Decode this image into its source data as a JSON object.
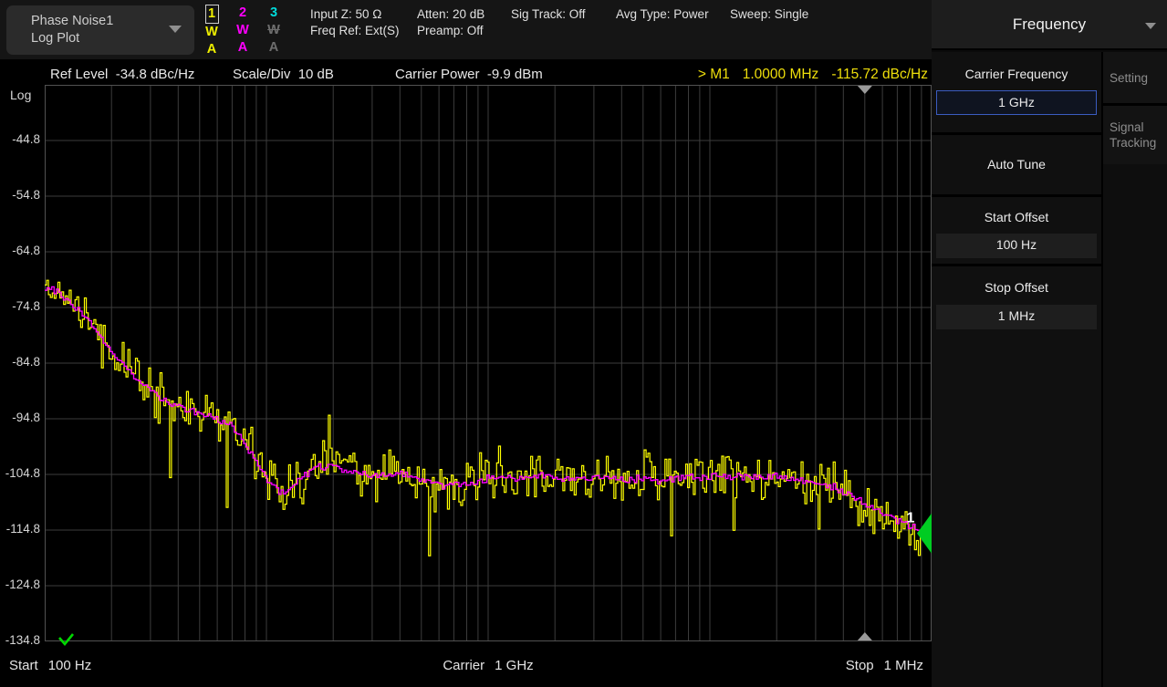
{
  "header": {
    "measurement_title": "Phase Noise1",
    "measurement_subtitle": "Log Plot",
    "traces": [
      {
        "id": "1",
        "detector": "W",
        "average": "A",
        "color": "#f0f000",
        "selected": true,
        "enabled": true
      },
      {
        "id": "2",
        "detector": "W",
        "average": "A",
        "color": "#ff00ff",
        "selected": false,
        "enabled": true
      },
      {
        "id": "3",
        "detector": "W",
        "average": "A",
        "color": "#00dcdc",
        "disabled_color": "#6e6e6e",
        "selected": false,
        "enabled": false
      }
    ],
    "settings": [
      {
        "line1": "Input Z: 50 Ω",
        "line2": "Freq Ref: Ext(S)"
      },
      {
        "line1": "Atten: 20 dB",
        "line2": "Preamp: Off"
      },
      {
        "line1": "Sig Track: Off",
        "line2": ""
      },
      {
        "line1": "Avg Type: Power",
        "line2": ""
      },
      {
        "line1": "Sweep: Single",
        "line2": ""
      }
    ]
  },
  "chart_header": {
    "ref_level": "Ref Level  -34.8 dBc/Hz",
    "scale_div": "Scale/Div  10 dB",
    "carrier_power": "Carrier Power  -9.9 dBm",
    "marker": {
      "prefix": "> M1",
      "freq": "1.0000 MHz",
      "value": "-115.72 dBc/Hz"
    }
  },
  "footer": {
    "start_label": "Start",
    "start_value": "100 Hz",
    "carrier_label": "Carrier",
    "carrier_value": "1 GHz",
    "stop_label": "Stop",
    "stop_value": "1 MHz"
  },
  "side_panel": {
    "title": "Frequency",
    "sections": [
      {
        "label": "Carrier Frequency",
        "value": "1 GHz",
        "highlighted": true
      },
      {
        "label": "Auto Tune"
      },
      {
        "label": "Start Offset",
        "value": "100 Hz"
      },
      {
        "label": "Stop Offset",
        "value": "1 MHz"
      }
    ],
    "tabs": [
      {
        "label": "Setting"
      },
      {
        "label_line1": "Signal",
        "label_line2": "Tracking"
      }
    ]
  },
  "chart_data": {
    "type": "line",
    "title": "Phase Noise1 Log Plot",
    "x_scale": "log",
    "x_range_hz": [
      100,
      1000000
    ],
    "y_top_dbchz": -34.8,
    "y_bottom_dbchz": -134.8,
    "scale_per_div_db": 10,
    "ylabel": "Log",
    "y_ticks": [
      "-44.8",
      "-54.8",
      "-64.8",
      "-74.8",
      "-84.8",
      "-94.8",
      "-104.8",
      "-114.8",
      "-124.8",
      "-134.8"
    ],
    "grid_color": "#3c3c3c",
    "frame_color": "#525252",
    "edge_tick_hz": 500000,
    "edge_tick_color": "#9a9a9a",
    "series": [
      {
        "name": "Trace 1 raw (W)",
        "color": "#ffff00",
        "style": "noisy-step",
        "peak_noise_db": 10
      },
      {
        "name": "Trace 2 smoothed (W)",
        "color": "#ff00ff",
        "style": "smooth-step"
      }
    ],
    "envelope_points_hz_dbchz": [
      [
        100,
        -71.3
      ],
      [
        112,
        -71.8
      ],
      [
        125,
        -73.2
      ],
      [
        140,
        -75.0
      ],
      [
        160,
        -77.5
      ],
      [
        180,
        -80.5
      ],
      [
        200,
        -83.0
      ],
      [
        230,
        -85.5
      ],
      [
        260,
        -87.5
      ],
      [
        300,
        -89.8
      ],
      [
        350,
        -91.5
      ],
      [
        400,
        -92.6
      ],
      [
        450,
        -93.2
      ],
      [
        500,
        -93.8
      ],
      [
        560,
        -94.6
      ],
      [
        630,
        -95.4
      ],
      [
        700,
        -96.5
      ],
      [
        800,
        -99.5
      ],
      [
        900,
        -102.8
      ],
      [
        1000,
        -105.6
      ],
      [
        1150,
        -108.0
      ],
      [
        1300,
        -107.0
      ],
      [
        1500,
        -104.8
      ],
      [
        1700,
        -103.4
      ],
      [
        2000,
        -103.2
      ],
      [
        2300,
        -104.2
      ],
      [
        2700,
        -105.0
      ],
      [
        3200,
        -105.0
      ],
      [
        4000,
        -104.6
      ],
      [
        5000,
        -105.8
      ],
      [
        6000,
        -107.0
      ],
      [
        7000,
        -106.8
      ],
      [
        8000,
        -106.2
      ],
      [
        10000,
        -105.6
      ],
      [
        12000,
        -105.2
      ],
      [
        15000,
        -105.5
      ],
      [
        18000,
        -105.1
      ],
      [
        22000,
        -105.4
      ],
      [
        27000,
        -105.8
      ],
      [
        33000,
        -105.3
      ],
      [
        40000,
        -105.9
      ],
      [
        50000,
        -105.4
      ],
      [
        60000,
        -105.8
      ],
      [
        75000,
        -105.2
      ],
      [
        90000,
        -105.5
      ],
      [
        110000,
        -105.2
      ],
      [
        130000,
        -105.0
      ],
      [
        160000,
        -105.4
      ],
      [
        200000,
        -105.3
      ],
      [
        250000,
        -105.8
      ],
      [
        300000,
        -106.2
      ],
      [
        360000,
        -107.2
      ],
      [
        430000,
        -108.6
      ],
      [
        520000,
        -110.4
      ],
      [
        620000,
        -112.0
      ],
      [
        740000,
        -113.5
      ],
      [
        870000,
        -114.8
      ],
      [
        1000000,
        -115.7
      ]
    ],
    "marker": {
      "id": "M1",
      "id_short": "1",
      "freq_hz": 1000000,
      "freq_label": "1.0000 MHz",
      "value_db": -115.72,
      "value_label": "-115.72 dBc/Hz",
      "color": "#00cc22"
    }
  }
}
